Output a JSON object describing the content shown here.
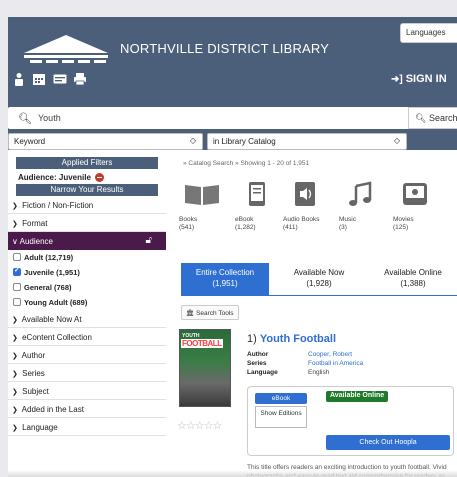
{
  "header": {
    "library_name": "NORTHVILLE DISTRICT LIBRARY",
    "languages_label": "Languages",
    "sign_in_label": "SIGN IN",
    "icons": [
      "person-icon",
      "calendar-icon",
      "card-icon",
      "print-icon"
    ]
  },
  "search": {
    "query": "Youth",
    "button_label": "Search",
    "field_select": "Keyword",
    "scope_select": "in Library Catalog"
  },
  "sidebar": {
    "applied_filters_title": "Applied Filters",
    "applied_filter": "Audience: Juvenile",
    "narrow_title": "Narrow Your Results",
    "nav_top": [
      "Fiction / Non-Fiction",
      "Format"
    ],
    "audience_label": "Audience",
    "audience_facets": [
      {
        "label": "Adult (12,719)",
        "checked": false
      },
      {
        "label": "Juvenile (1,951)",
        "checked": true
      },
      {
        "label": "General (768)",
        "checked": false
      },
      {
        "label": "Young Adult (689)",
        "checked": false
      }
    ],
    "nav_bottom": [
      "Available Now At",
      "eContent Collection",
      "Author",
      "Series",
      "Subject",
      "Added in the Last",
      "Language"
    ]
  },
  "main": {
    "breadcrumb": "» Catalog Search  » Showing 1 - 20 of 1,951",
    "formats": [
      {
        "name": "Books",
        "count": "(541)",
        "icon": "books-icon"
      },
      {
        "name": "eBook",
        "count": "(1,282)",
        "icon": "ebook-icon"
      },
      {
        "name": "Audio Books",
        "count": "(411)",
        "icon": "audiobook-icon"
      },
      {
        "name": "Music",
        "count": "(3)",
        "icon": "music-icon"
      },
      {
        "name": "Movies",
        "count": "(125)",
        "icon": "movies-icon"
      }
    ],
    "tabs": [
      {
        "label": "Entire Collection",
        "count": "(1,951)",
        "active": true
      },
      {
        "label": "Available Now",
        "count": "(1,928)",
        "active": false
      },
      {
        "label": "Available Online",
        "count": "(1,388)",
        "active": false
      }
    ],
    "tools_label": "Search Tools",
    "result": {
      "number": "1)",
      "title": "Youth Football",
      "cover_tag": "YOUTH",
      "cover_title": "FOOTBALL",
      "author_label": "Author",
      "author": "Cooper, Robert",
      "series_label": "Series",
      "series": "Football in America",
      "language_label": "Language",
      "language": "English",
      "format_button": "eBook",
      "show_editions": "Show Editions",
      "availability": "Available Online",
      "checkout_label": "Check Out Hoopla",
      "rating": "☆☆☆☆☆",
      "description": "This title offers readers an exciting introduction to youth football. Vivid photographs and easy-to-read text aid comprehension for readers as they learn about the game at"
    }
  },
  "colors": {
    "header": "#4c5f7a",
    "audience_header": "#4a1b4a",
    "accent": "#2f6fd1",
    "available": "#1e7a2a"
  }
}
